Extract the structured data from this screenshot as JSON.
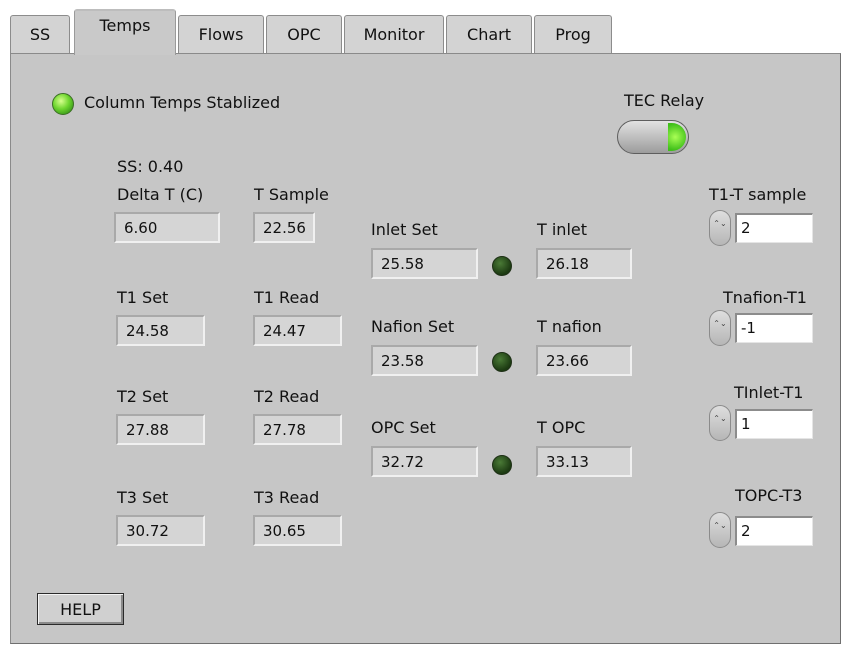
{
  "tabs": [
    {
      "label": "SS"
    },
    {
      "label": "Temps"
    },
    {
      "label": "Flows"
    },
    {
      "label": "OPC"
    },
    {
      "label": "Monitor"
    },
    {
      "label": "Chart"
    },
    {
      "label": "Prog"
    }
  ],
  "active_tab": "Temps",
  "status": {
    "column_temps_label": "Column Temps Stablized",
    "column_temps_led_color": "#6fd62f"
  },
  "tec_relay": {
    "label": "TEC Relay",
    "lamp_color": "#3fbf19"
  },
  "ss_value": "SS: 0.40",
  "delta_t": {
    "label": "Delta T (C)",
    "value": "6.60"
  },
  "t_sample": {
    "label": "T Sample",
    "value": "22.56"
  },
  "t1": {
    "set_label": "T1 Set",
    "set_value": "24.58",
    "read_label": "T1 Read",
    "read_value": "24.47"
  },
  "t2": {
    "set_label": "T2 Set",
    "set_value": "27.88",
    "read_label": "T2 Read",
    "read_value": "27.78"
  },
  "t3": {
    "set_label": "T3 Set",
    "set_value": "30.72",
    "read_label": "T3 Read",
    "read_value": "30.65"
  },
  "inlet": {
    "set_label": "Inlet Set",
    "set_value": "25.58",
    "read_label": "T inlet",
    "read_value": "26.18"
  },
  "nafion": {
    "set_label": "Nafion Set",
    "set_value": "23.58",
    "read_label": "T nafion",
    "read_value": "23.66"
  },
  "opc": {
    "set_label": "OPC Set",
    "set_value": "32.72",
    "read_label": "T OPC",
    "read_value": "33.13"
  },
  "offsets": {
    "t1_t_sample": {
      "label": "T1-T sample",
      "value": "2"
    },
    "tnafion_t1": {
      "label": "Tnafion-T1",
      "value": "-1"
    },
    "tinlet_t1": {
      "label": "TInlet-T1",
      "value": "1"
    },
    "topc_t3": {
      "label": "TOPC-T3",
      "value": "2"
    }
  },
  "spin_glyph": "⌃⌄",
  "help_label": "HELP",
  "colors": {
    "panel_bg": "#c6c6c6",
    "led_off": "#1c3a12",
    "led_on": "#6fd62f"
  }
}
